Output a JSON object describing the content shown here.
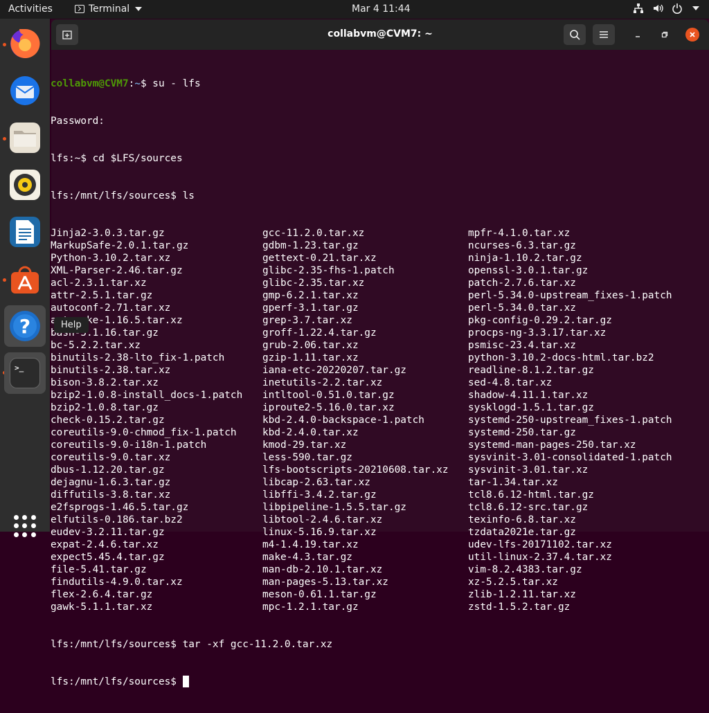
{
  "topbar": {
    "activities": "Activities",
    "app_menu": "Terminal",
    "clock": "Mar 4  11:44",
    "tray_icons": [
      "network-icon",
      "volume-icon",
      "power-icon",
      "chevron-down-icon"
    ]
  },
  "dock": {
    "items": [
      "firefox-icon",
      "thunderbird-icon",
      "files-icon",
      "rhythmbox-icon",
      "libreoffice-writer-icon",
      "software-center-icon",
      "help-icon",
      "terminal-icon"
    ],
    "tooltip": "Help",
    "show_apps": "show-applications-icon"
  },
  "window": {
    "title": "collabvm@CVM7: ~"
  },
  "terminal": {
    "prompt1_user": "collabvm@CVM7",
    "prompt1_sep": ":",
    "prompt1_path": "~",
    "prompt1_cmd": "$ su - lfs",
    "line2": "Password:",
    "line3": "lfs:~$ cd $LFS/sources",
    "line4": "lfs:/mnt/lfs/sources$ ls",
    "ls_col1": [
      "Jinja2-3.0.3.tar.gz",
      "MarkupSafe-2.0.1.tar.gz",
      "Python-3.10.2.tar.xz",
      "XML-Parser-2.46.tar.gz",
      "acl-2.3.1.tar.xz",
      "attr-2.5.1.tar.gz",
      "autoconf-2.71.tar.xz",
      "automake-1.16.5.tar.xz",
      "bash-5.1.16.tar.gz",
      "bc-5.2.2.tar.xz",
      "binutils-2.38-lto_fix-1.patch",
      "binutils-2.38.tar.xz",
      "bison-3.8.2.tar.xz",
      "bzip2-1.0.8-install_docs-1.patch",
      "bzip2-1.0.8.tar.gz",
      "check-0.15.2.tar.gz",
      "coreutils-9.0-chmod_fix-1.patch",
      "coreutils-9.0-i18n-1.patch",
      "coreutils-9.0.tar.xz",
      "dbus-1.12.20.tar.gz",
      "dejagnu-1.6.3.tar.gz",
      "diffutils-3.8.tar.xz",
      "e2fsprogs-1.46.5.tar.gz",
      "elfutils-0.186.tar.bz2",
      "eudev-3.2.11.tar.gz",
      "expat-2.4.6.tar.xz",
      "expect5.45.4.tar.gz",
      "file-5.41.tar.gz",
      "findutils-4.9.0.tar.xz",
      "flex-2.6.4.tar.gz",
      "gawk-5.1.1.tar.xz"
    ],
    "ls_col2": [
      "gcc-11.2.0.tar.xz",
      "gdbm-1.23.tar.gz",
      "gettext-0.21.tar.xz",
      "glibc-2.35-fhs-1.patch",
      "glibc-2.35.tar.xz",
      "gmp-6.2.1.tar.xz",
      "gperf-3.1.tar.gz",
      "grep-3.7.tar.xz",
      "groff-1.22.4.tar.gz",
      "grub-2.06.tar.xz",
      "gzip-1.11.tar.xz",
      "iana-etc-20220207.tar.gz",
      "inetutils-2.2.tar.xz",
      "intltool-0.51.0.tar.gz",
      "iproute2-5.16.0.tar.xz",
      "kbd-2.4.0-backspace-1.patch",
      "kbd-2.4.0.tar.xz",
      "kmod-29.tar.xz",
      "less-590.tar.gz",
      "lfs-bootscripts-20210608.tar.xz",
      "libcap-2.63.tar.xz",
      "libffi-3.4.2.tar.gz",
      "libpipeline-1.5.5.tar.gz",
      "libtool-2.4.6.tar.xz",
      "linux-5.16.9.tar.xz",
      "m4-1.4.19.tar.xz",
      "make-4.3.tar.gz",
      "man-db-2.10.1.tar.xz",
      "man-pages-5.13.tar.xz",
      "meson-0.61.1.tar.gz",
      "mpc-1.2.1.tar.gz"
    ],
    "ls_col3": [
      "mpfr-4.1.0.tar.xz",
      "ncurses-6.3.tar.gz",
      "ninja-1.10.2.tar.gz",
      "openssl-3.0.1.tar.gz",
      "patch-2.7.6.tar.xz",
      "perl-5.34.0-upstream_fixes-1.patch",
      "perl-5.34.0.tar.xz",
      "pkg-config-0.29.2.tar.gz",
      "procps-ng-3.3.17.tar.xz",
      "psmisc-23.4.tar.xz",
      "python-3.10.2-docs-html.tar.bz2",
      "readline-8.1.2.tar.gz",
      "sed-4.8.tar.xz",
      "shadow-4.11.1.tar.xz",
      "sysklogd-1.5.1.tar.gz",
      "systemd-250-upstream_fixes-1.patch",
      "systemd-250.tar.gz",
      "systemd-man-pages-250.tar.xz",
      "sysvinit-3.01-consolidated-1.patch",
      "sysvinit-3.01.tar.xz",
      "tar-1.34.tar.xz",
      "tcl8.6.12-html.tar.gz",
      "tcl8.6.12-src.tar.gz",
      "texinfo-6.8.tar.xz",
      "tzdata2021e.tar.gz",
      "udev-lfs-20171102.tar.xz",
      "util-linux-2.37.4.tar.xz",
      "vim-8.2.4383.tar.gz",
      "xz-5.2.5.tar.xz",
      "zlib-1.2.11.tar.xz",
      "zstd-1.5.2.tar.gz"
    ],
    "line_tar": "lfs:/mnt/lfs/sources$ tar -xf gcc-11.2.0.tar.xz",
    "line_last": "lfs:/mnt/lfs/sources$ "
  }
}
